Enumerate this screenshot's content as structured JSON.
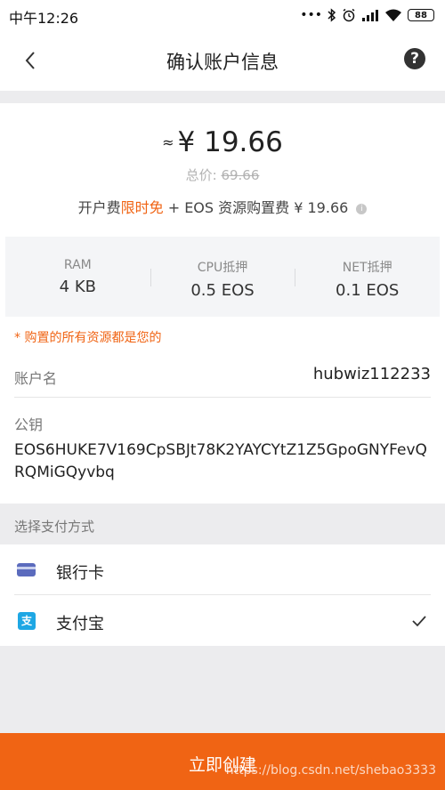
{
  "status_bar": {
    "time": "中午12:26",
    "dots": "•••",
    "battery": "88"
  },
  "nav": {
    "title": "确认账户信息",
    "help": "?"
  },
  "summary": {
    "approx": "≈",
    "price": "¥ 19.66",
    "total_label": "总价:",
    "total_value": "69.66",
    "fee_prefix": "开户费",
    "fee_free": "限时免",
    "fee_suffix": "+ EOS 资源购置费 ¥ 19.66",
    "info_icon": "i"
  },
  "resources": [
    {
      "label": "RAM",
      "value": "4 KB"
    },
    {
      "label": "CPU抵押",
      "value": "0.5 EOS"
    },
    {
      "label": "NET抵押",
      "value": "0.1 EOS"
    }
  ],
  "notice": "* 购置的所有资源都是您的",
  "account": {
    "label": "账户名",
    "value": "hubwiz112233"
  },
  "public_key": {
    "label": "公钥",
    "value": "EOS6HUKE7V169CpSBJt78K2YAYCYtZ1Z5GpoGNYFevQRQMiGQyvbq"
  },
  "payment": {
    "header": "选择支付方式",
    "options": [
      {
        "label": "银行卡",
        "icon": "bank-card-icon",
        "selected": false
      },
      {
        "label": "支付宝",
        "icon": "alipay-icon",
        "icon_text": "支",
        "selected": true
      }
    ]
  },
  "create_button": {
    "label": "立即创建"
  },
  "watermark": "https://blog.csdn.net/shebao3333",
  "colors": {
    "accent": "#f06414",
    "alipay": "#1ea7e4",
    "bank": "#5b6bbd"
  }
}
